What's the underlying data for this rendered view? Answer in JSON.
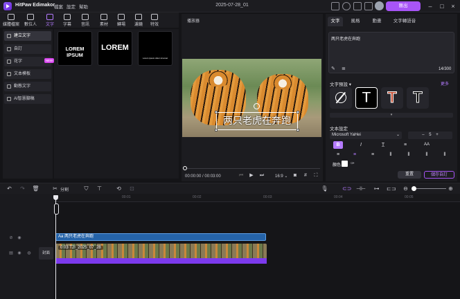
{
  "app": {
    "name": "HitPaw Edimakor",
    "document_title": "2025-07-28_01"
  },
  "menu": [
    "檔案",
    "設定",
    "幫助"
  ],
  "export_label": "匯出",
  "toolbar": [
    {
      "label": "媒體檔案",
      "icon": "media-icon"
    },
    {
      "label": "數位人",
      "icon": "avatar-person-icon"
    },
    {
      "label": "文字",
      "icon": "text-icon",
      "active": true
    },
    {
      "label": "字幕",
      "icon": "subtitle-icon"
    },
    {
      "label": "音訊",
      "icon": "audio-icon"
    },
    {
      "label": "素材",
      "icon": "stock-icon"
    },
    {
      "label": "轉場",
      "icon": "transition-icon"
    },
    {
      "label": "濾鏡",
      "icon": "filter-icon"
    },
    {
      "label": "特效",
      "icon": "effects-icon"
    }
  ],
  "text_categories": [
    {
      "label": "建立文字",
      "selected": true
    },
    {
      "label": "自訂"
    },
    {
      "label": "花字",
      "badge": "NEW"
    },
    {
      "label": "文本模板"
    },
    {
      "label": "動態文字"
    },
    {
      "label": "AI智慧腳稿"
    }
  ],
  "templates": [
    {
      "text": "LOREM IPSUM"
    },
    {
      "text": "LOREM"
    },
    {
      "text": "Lorem ipsum dolor sit amet"
    }
  ],
  "player": {
    "title": "播放器",
    "caption": "两只老虎在奔跑",
    "current_time": "00:00:00",
    "total_time": "00:03:00",
    "aspect": "16:9"
  },
  "right_panel": {
    "tabs": [
      "文字",
      "風格",
      "動畫",
      "文字轉語音"
    ],
    "active_tab": "文字",
    "text_value": "两只老虎在奔跑",
    "char_count": "14/300",
    "presets_label": "文字預設",
    "more_label": "更多",
    "text_settings_label": "文本設定",
    "font": "Microsoft YaHei",
    "font_size": "5",
    "color_label": "顏色",
    "color_value": "#ffffff",
    "reset_label": "重置",
    "save_label": "儲存自訂"
  },
  "edit_toolbar": {
    "split_label": "分割"
  },
  "timeline": {
    "ruler_marks": [
      "00:00",
      "00:01",
      "00:02",
      "00:03",
      "00:04",
      "00:05"
    ],
    "text_clip": "两只老虎在奔跑",
    "video_clip": "0:03  T2I_2025_07_28",
    "cover_label": "封面"
  }
}
